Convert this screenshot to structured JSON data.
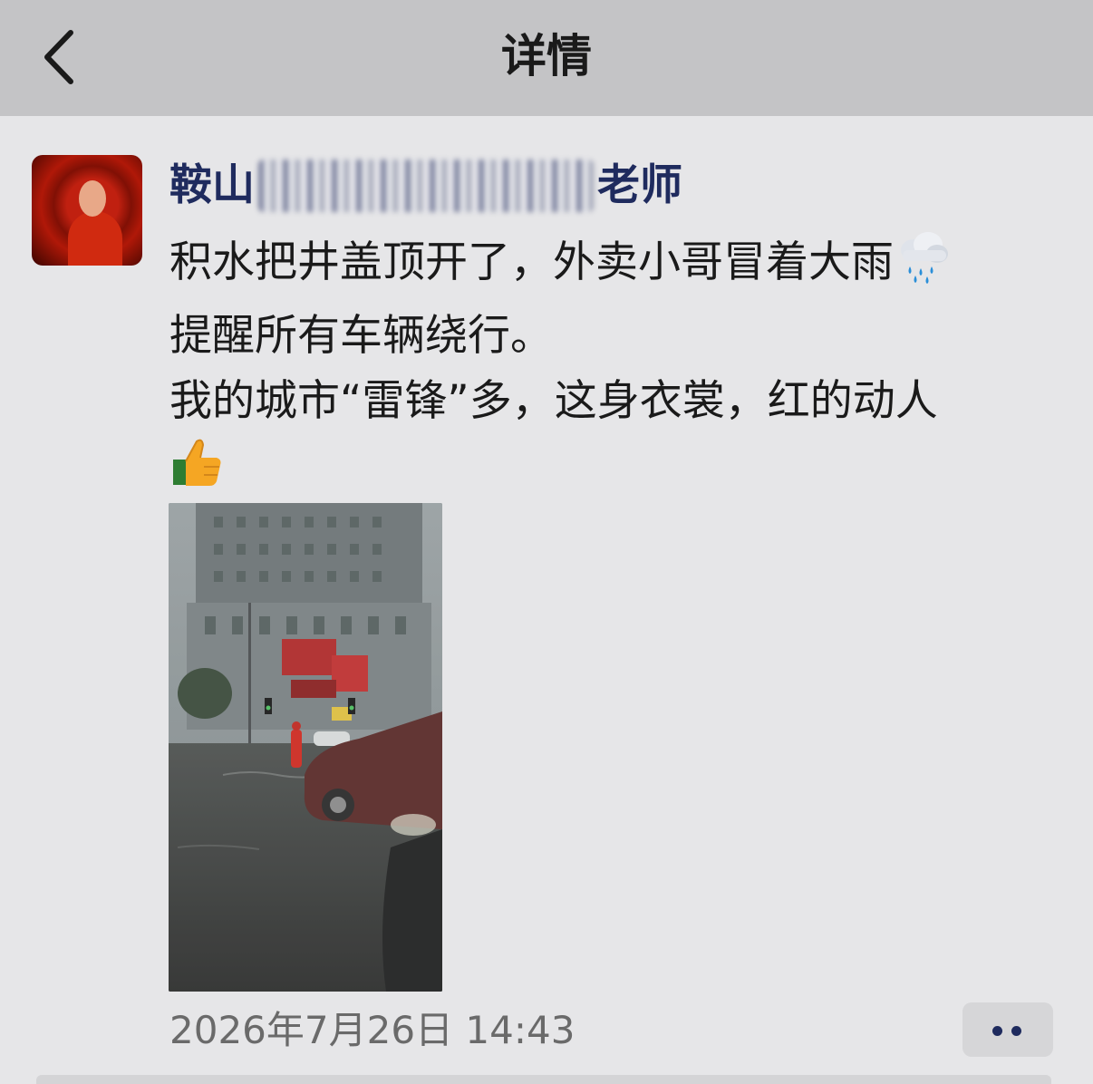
{
  "nav": {
    "title": "详情"
  },
  "post": {
    "author_prefix": "鞍山",
    "author_suffix": "老师",
    "text_lines": [
      "积水把井盖顶开了，外卖小哥冒着大雨",
      "提醒所有车辆绕行。",
      "我的城市“雷锋”多，这身衣裳，红的动人"
    ],
    "emoji_rain": "rain-cloud-icon",
    "emoji_thumb": "thumbs-up-icon",
    "timestamp": "2026年7月26日 14:43"
  },
  "icons": {
    "back": "chevron-left-icon",
    "more": "more-dots-icon"
  },
  "colors": {
    "nav_bg": "#c4c4c6",
    "page_bg": "#e6e6e8",
    "name_color": "#1f2b5e",
    "timestamp_color": "#6a6a6a"
  }
}
